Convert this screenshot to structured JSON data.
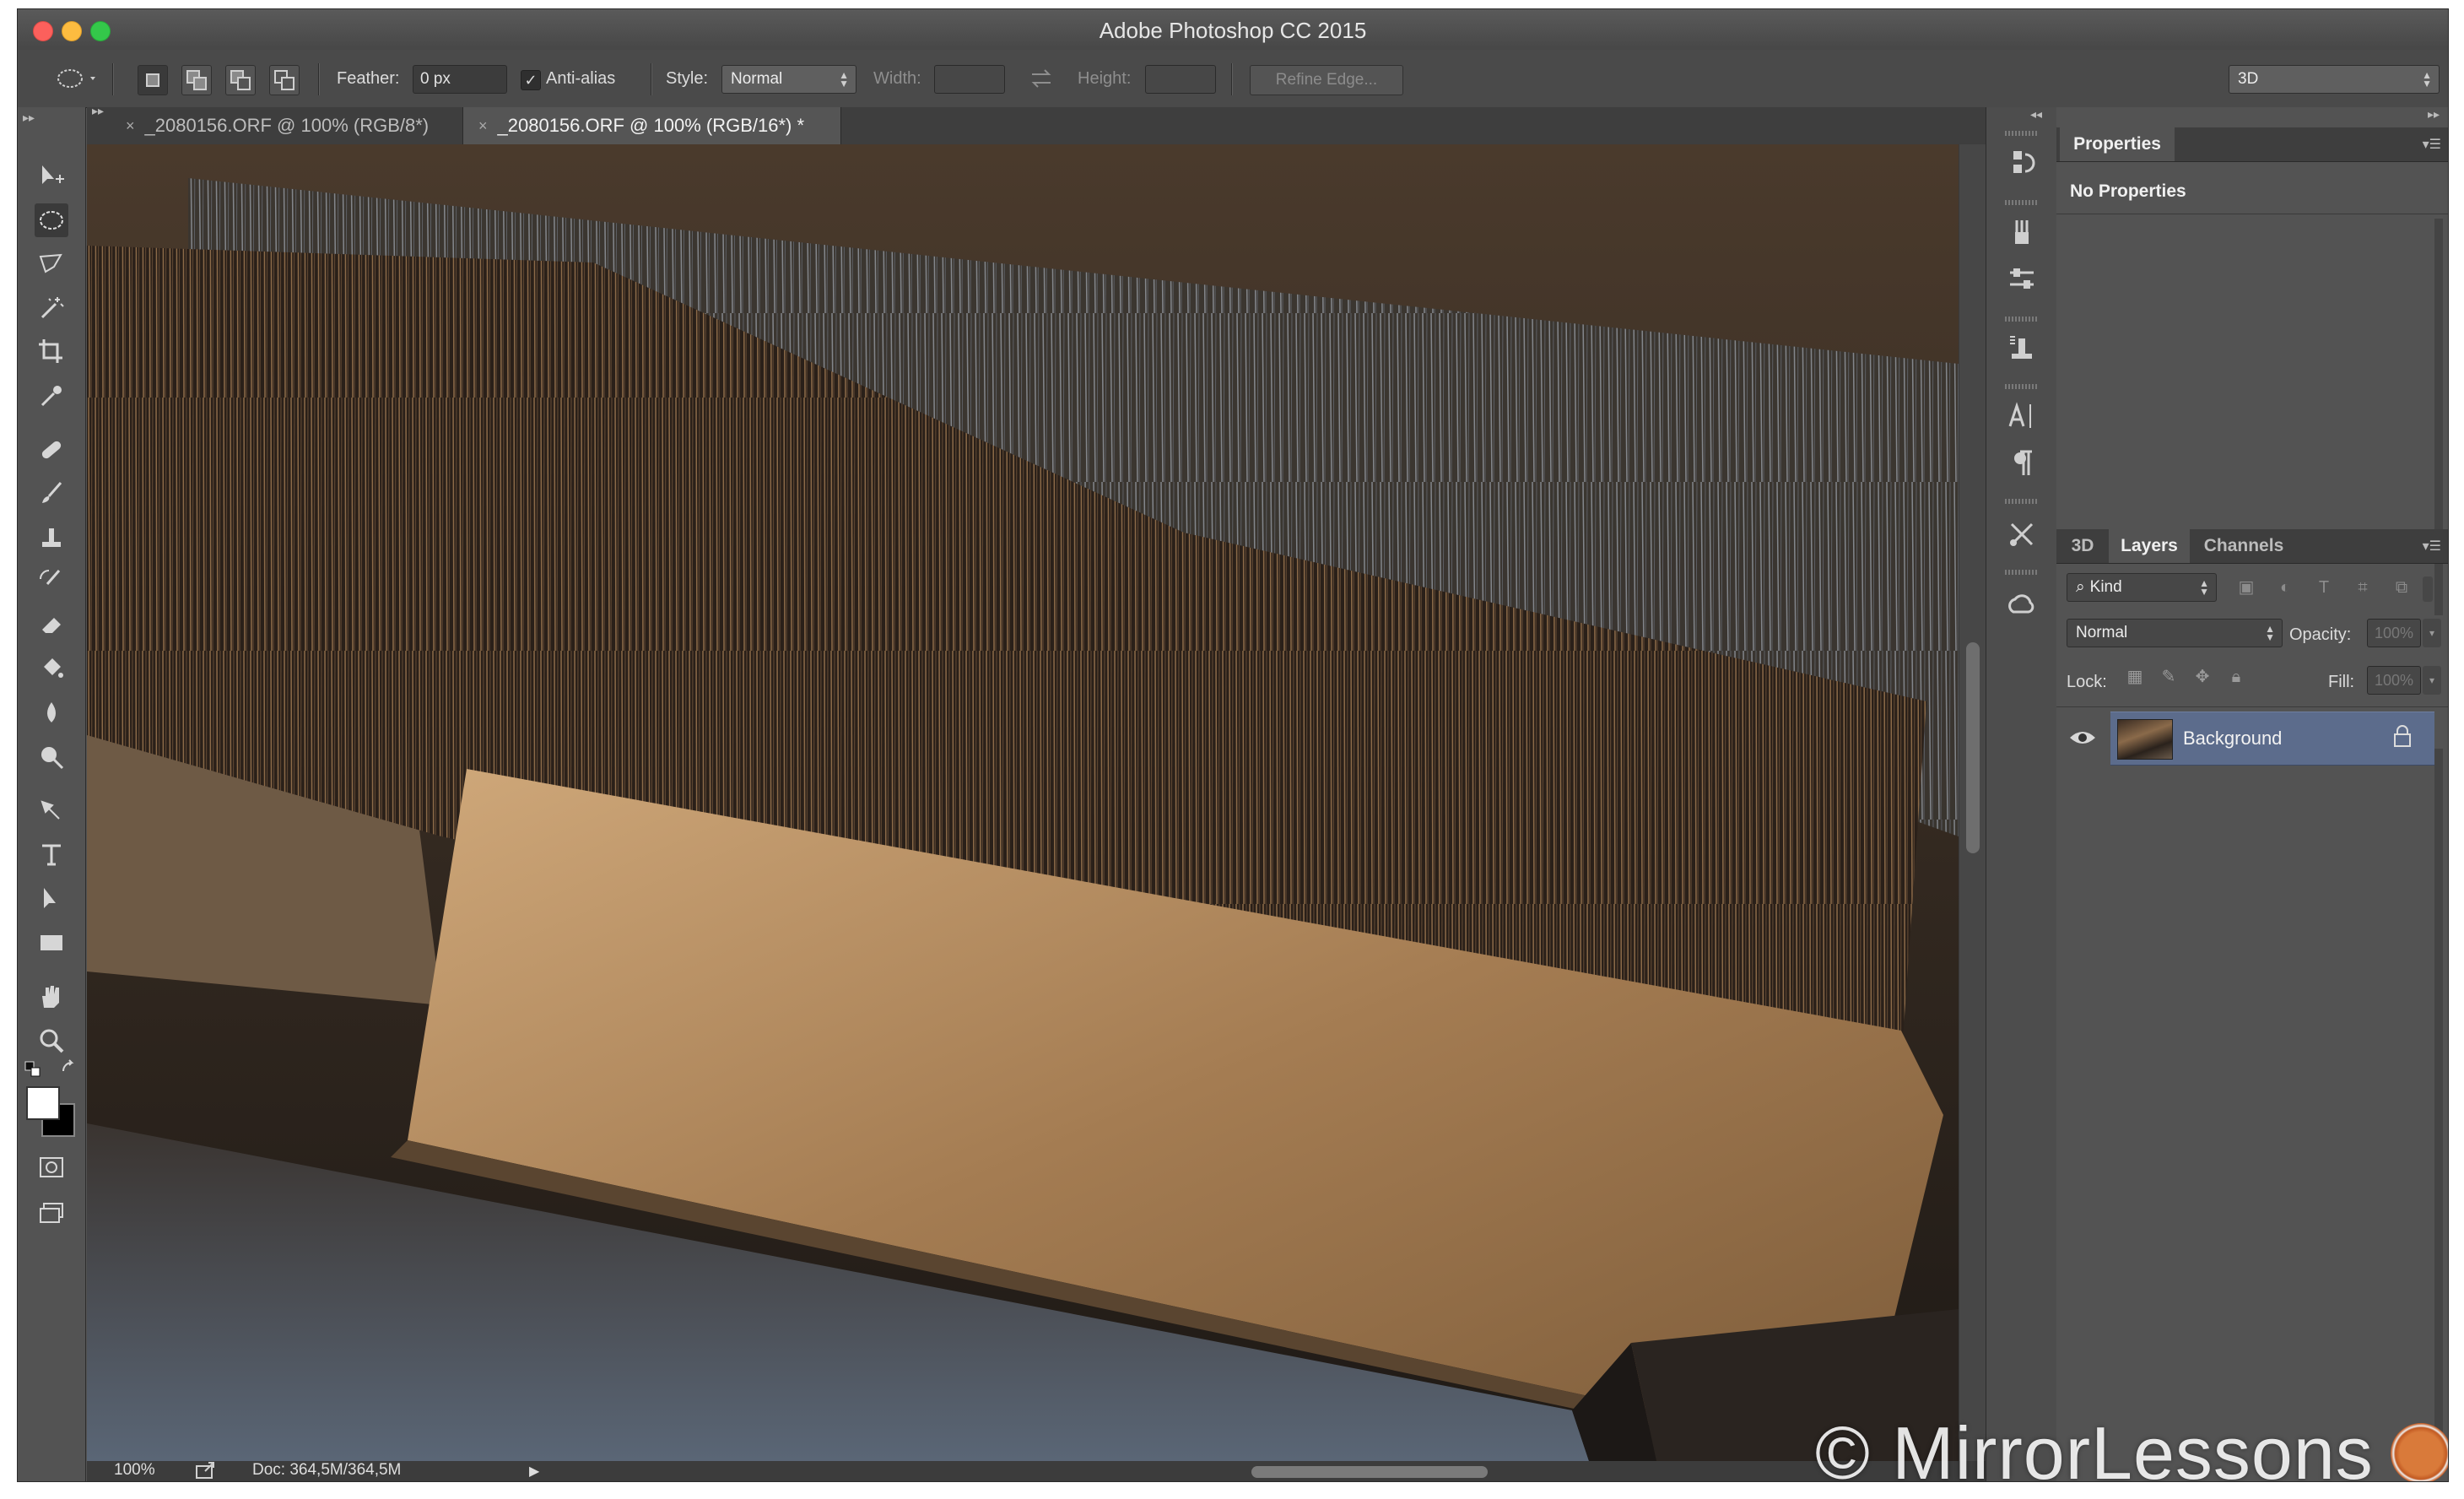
{
  "window": {
    "title": "Adobe Photoshop CC 2015"
  },
  "options_bar": {
    "feather_label": "Feather:",
    "feather_value": "0 px",
    "anti_alias_label": "Anti-alias",
    "anti_alias_checked": true,
    "style_label": "Style:",
    "style_value": "Normal",
    "width_label": "Width:",
    "height_label": "Height:",
    "refine_edge_label": "Refine Edge...",
    "workspace_value": "3D"
  },
  "document_tabs": [
    {
      "label": "_2080156.ORF @ 100% (RGB/8*)",
      "active": false
    },
    {
      "label": "_2080156.ORF @ 100% (RGB/16*) *",
      "active": true
    }
  ],
  "status_bar": {
    "zoom": "100%",
    "doc_info": "Doc: 364,5M/364,5M"
  },
  "properties_panel": {
    "tab_label": "Properties",
    "content": "No Properties"
  },
  "layers_panel": {
    "tabs": [
      "3D",
      "Layers",
      "Channels"
    ],
    "active_tab": "Layers",
    "filter_kind": "Kind",
    "blend_mode": "Normal",
    "opacity_label": "Opacity:",
    "opacity_value": "100%",
    "lock_label": "Lock:",
    "fill_label": "Fill:",
    "fill_value": "100%",
    "layers": [
      {
        "name": "Background",
        "visible": true,
        "locked": true
      }
    ]
  },
  "watermark": {
    "text": "© MirrorLessons"
  },
  "tools": [
    "move-tool-icon",
    "elliptical-marquee-tool-icon",
    "polygonal-lasso-tool-icon",
    "magic-wand-tool-icon",
    "crop-tool-icon",
    "eyedropper-tool-icon",
    "spot-healing-brush-icon",
    "brush-tool-icon",
    "clone-stamp-icon",
    "history-brush-icon",
    "eraser-tool-icon",
    "paint-bucket-icon",
    "blur-tool-icon",
    "dodge-tool-icon",
    "pen-tool-icon",
    "type-tool-icon",
    "path-selection-icon",
    "rectangle-tool-icon",
    "hand-tool-icon",
    "zoom-tool-icon"
  ],
  "colors": {
    "foreground": "#ffffff",
    "background": "#000000",
    "selected_layer": "#5c6c8c",
    "window_bg": "#535353"
  }
}
